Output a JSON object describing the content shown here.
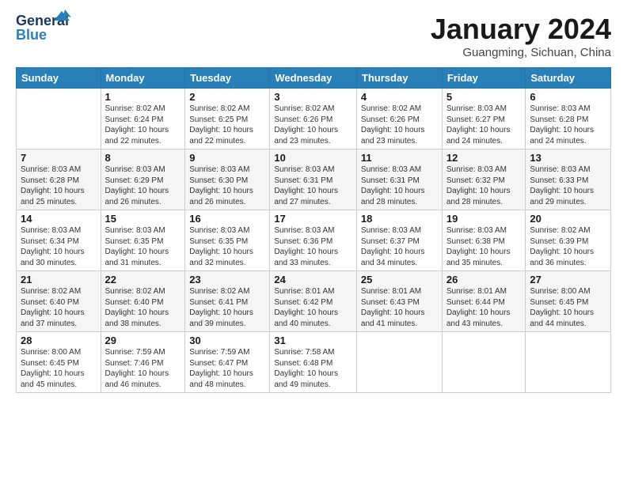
{
  "header": {
    "logo_general": "General",
    "logo_blue": "Blue",
    "month_title": "January 2024",
    "subtitle": "Guangming, Sichuan, China"
  },
  "days_of_week": [
    "Sunday",
    "Monday",
    "Tuesday",
    "Wednesday",
    "Thursday",
    "Friday",
    "Saturday"
  ],
  "weeks": [
    [
      {
        "day": "",
        "sunrise": "",
        "sunset": "",
        "daylight": ""
      },
      {
        "day": "1",
        "sunrise": "Sunrise: 8:02 AM",
        "sunset": "Sunset: 6:24 PM",
        "daylight": "Daylight: 10 hours and 22 minutes."
      },
      {
        "day": "2",
        "sunrise": "Sunrise: 8:02 AM",
        "sunset": "Sunset: 6:25 PM",
        "daylight": "Daylight: 10 hours and 22 minutes."
      },
      {
        "day": "3",
        "sunrise": "Sunrise: 8:02 AM",
        "sunset": "Sunset: 6:26 PM",
        "daylight": "Daylight: 10 hours and 23 minutes."
      },
      {
        "day": "4",
        "sunrise": "Sunrise: 8:02 AM",
        "sunset": "Sunset: 6:26 PM",
        "daylight": "Daylight: 10 hours and 23 minutes."
      },
      {
        "day": "5",
        "sunrise": "Sunrise: 8:03 AM",
        "sunset": "Sunset: 6:27 PM",
        "daylight": "Daylight: 10 hours and 24 minutes."
      },
      {
        "day": "6",
        "sunrise": "Sunrise: 8:03 AM",
        "sunset": "Sunset: 6:28 PM",
        "daylight": "Daylight: 10 hours and 24 minutes."
      }
    ],
    [
      {
        "day": "7",
        "sunrise": "Sunrise: 8:03 AM",
        "sunset": "Sunset: 6:28 PM",
        "daylight": "Daylight: 10 hours and 25 minutes."
      },
      {
        "day": "8",
        "sunrise": "Sunrise: 8:03 AM",
        "sunset": "Sunset: 6:29 PM",
        "daylight": "Daylight: 10 hours and 26 minutes."
      },
      {
        "day": "9",
        "sunrise": "Sunrise: 8:03 AM",
        "sunset": "Sunset: 6:30 PM",
        "daylight": "Daylight: 10 hours and 26 minutes."
      },
      {
        "day": "10",
        "sunrise": "Sunrise: 8:03 AM",
        "sunset": "Sunset: 6:31 PM",
        "daylight": "Daylight: 10 hours and 27 minutes."
      },
      {
        "day": "11",
        "sunrise": "Sunrise: 8:03 AM",
        "sunset": "Sunset: 6:31 PM",
        "daylight": "Daylight: 10 hours and 28 minutes."
      },
      {
        "day": "12",
        "sunrise": "Sunrise: 8:03 AM",
        "sunset": "Sunset: 6:32 PM",
        "daylight": "Daylight: 10 hours and 28 minutes."
      },
      {
        "day": "13",
        "sunrise": "Sunrise: 8:03 AM",
        "sunset": "Sunset: 6:33 PM",
        "daylight": "Daylight: 10 hours and 29 minutes."
      }
    ],
    [
      {
        "day": "14",
        "sunrise": "Sunrise: 8:03 AM",
        "sunset": "Sunset: 6:34 PM",
        "daylight": "Daylight: 10 hours and 30 minutes."
      },
      {
        "day": "15",
        "sunrise": "Sunrise: 8:03 AM",
        "sunset": "Sunset: 6:35 PM",
        "daylight": "Daylight: 10 hours and 31 minutes."
      },
      {
        "day": "16",
        "sunrise": "Sunrise: 8:03 AM",
        "sunset": "Sunset: 6:35 PM",
        "daylight": "Daylight: 10 hours and 32 minutes."
      },
      {
        "day": "17",
        "sunrise": "Sunrise: 8:03 AM",
        "sunset": "Sunset: 6:36 PM",
        "daylight": "Daylight: 10 hours and 33 minutes."
      },
      {
        "day": "18",
        "sunrise": "Sunrise: 8:03 AM",
        "sunset": "Sunset: 6:37 PM",
        "daylight": "Daylight: 10 hours and 34 minutes."
      },
      {
        "day": "19",
        "sunrise": "Sunrise: 8:03 AM",
        "sunset": "Sunset: 6:38 PM",
        "daylight": "Daylight: 10 hours and 35 minutes."
      },
      {
        "day": "20",
        "sunrise": "Sunrise: 8:02 AM",
        "sunset": "Sunset: 6:39 PM",
        "daylight": "Daylight: 10 hours and 36 minutes."
      }
    ],
    [
      {
        "day": "21",
        "sunrise": "Sunrise: 8:02 AM",
        "sunset": "Sunset: 6:40 PM",
        "daylight": "Daylight: 10 hours and 37 minutes."
      },
      {
        "day": "22",
        "sunrise": "Sunrise: 8:02 AM",
        "sunset": "Sunset: 6:40 PM",
        "daylight": "Daylight: 10 hours and 38 minutes."
      },
      {
        "day": "23",
        "sunrise": "Sunrise: 8:02 AM",
        "sunset": "Sunset: 6:41 PM",
        "daylight": "Daylight: 10 hours and 39 minutes."
      },
      {
        "day": "24",
        "sunrise": "Sunrise: 8:01 AM",
        "sunset": "Sunset: 6:42 PM",
        "daylight": "Daylight: 10 hours and 40 minutes."
      },
      {
        "day": "25",
        "sunrise": "Sunrise: 8:01 AM",
        "sunset": "Sunset: 6:43 PM",
        "daylight": "Daylight: 10 hours and 41 minutes."
      },
      {
        "day": "26",
        "sunrise": "Sunrise: 8:01 AM",
        "sunset": "Sunset: 6:44 PM",
        "daylight": "Daylight: 10 hours and 43 minutes."
      },
      {
        "day": "27",
        "sunrise": "Sunrise: 8:00 AM",
        "sunset": "Sunset: 6:45 PM",
        "daylight": "Daylight: 10 hours and 44 minutes."
      }
    ],
    [
      {
        "day": "28",
        "sunrise": "Sunrise: 8:00 AM",
        "sunset": "Sunset: 6:45 PM",
        "daylight": "Daylight: 10 hours and 45 minutes."
      },
      {
        "day": "29",
        "sunrise": "Sunrise: 7:59 AM",
        "sunset": "Sunset: 7:46 PM",
        "daylight": "Daylight: 10 hours and 46 minutes."
      },
      {
        "day": "30",
        "sunrise": "Sunrise: 7:59 AM",
        "sunset": "Sunset: 6:47 PM",
        "daylight": "Daylight: 10 hours and 48 minutes."
      },
      {
        "day": "31",
        "sunrise": "Sunrise: 7:58 AM",
        "sunset": "Sunset: 6:48 PM",
        "daylight": "Daylight: 10 hours and 49 minutes."
      },
      {
        "day": "",
        "sunrise": "",
        "sunset": "",
        "daylight": ""
      },
      {
        "day": "",
        "sunrise": "",
        "sunset": "",
        "daylight": ""
      },
      {
        "day": "",
        "sunrise": "",
        "sunset": "",
        "daylight": ""
      }
    ]
  ]
}
